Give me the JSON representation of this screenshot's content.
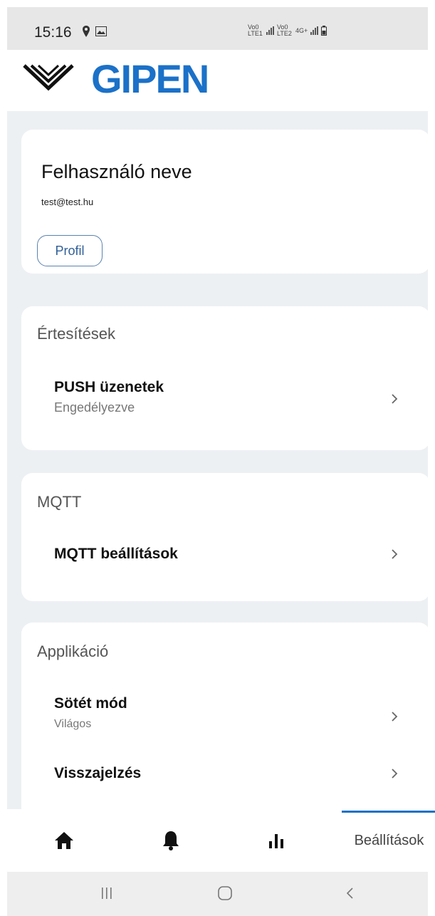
{
  "status_bar": {
    "time": "15:16",
    "network_labels": [
      "Vo0 LTE1",
      "Vo0 LTE2",
      "4G+"
    ]
  },
  "header": {
    "logo_text": "GIPEN",
    "logo_color": "#1b71c8"
  },
  "profile": {
    "name": "Felhasználó neve",
    "email": "test@test.hu",
    "button_label": "Profil"
  },
  "notifications": {
    "title": "Értesítések",
    "push": {
      "label": "PUSH üzenetek",
      "value": "Engedélyezve"
    }
  },
  "mqtt": {
    "title": "MQTT",
    "settings": {
      "label": "MQTT beállítások"
    }
  },
  "application": {
    "title": "Applikáció",
    "dark_mode": {
      "label": "Sötét mód",
      "value": "Világos"
    },
    "feedback": {
      "label": "Visszajelzés"
    }
  },
  "bottom_nav": {
    "items": [
      {
        "icon": "home-icon"
      },
      {
        "icon": "bell-icon"
      },
      {
        "icon": "bar-chart-icon"
      },
      {
        "label": "Beállítások",
        "active": true
      }
    ]
  },
  "system_nav": {
    "icons": [
      "recent-apps-icon",
      "home-circle-icon",
      "back-icon"
    ]
  }
}
